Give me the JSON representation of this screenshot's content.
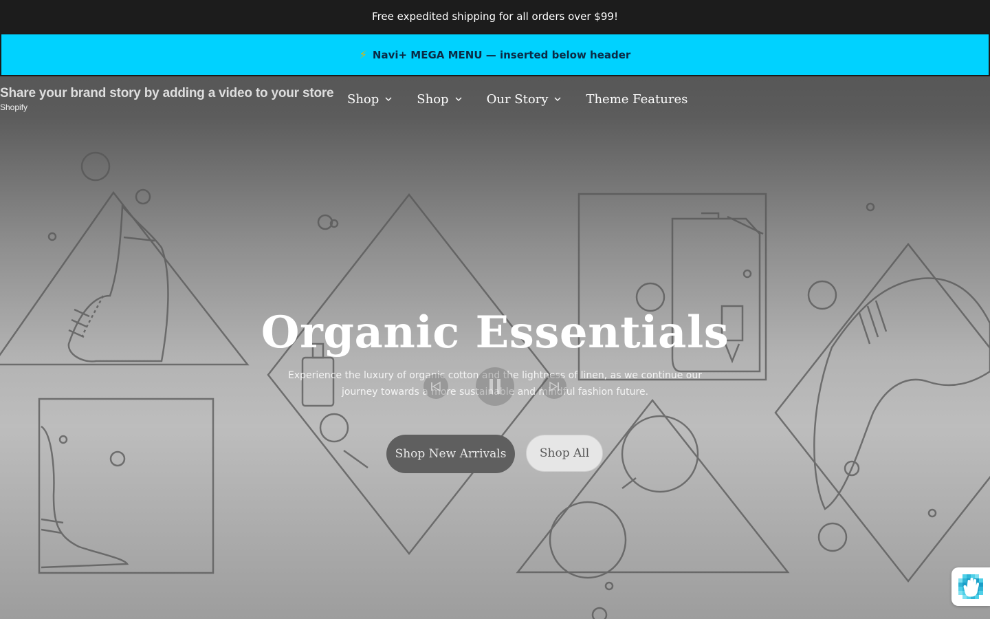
{
  "announcement": {
    "text": "Free expedited shipping for all orders over $99!"
  },
  "mega_banner": {
    "icon": "lightning-bolt-icon",
    "text": "Navi+ MEGA MENU — inserted below header",
    "background": "#00d2ff"
  },
  "video_overlay": {
    "title": "Share your brand story by adding a video to your store",
    "channel": "Shopify"
  },
  "nav": {
    "items": [
      {
        "label": "Shop",
        "has_dropdown": true
      },
      {
        "label": "Shop",
        "has_dropdown": true
      },
      {
        "label": "Our Story",
        "has_dropdown": true
      },
      {
        "label": "Theme Features",
        "has_dropdown": false
      }
    ],
    "chevron": "⌄"
  },
  "hero": {
    "title": "Organic Essentials",
    "subtitle": "Experience the luxury of organic cotton and the lightness of linen, as we continue our journey towards a more sustainable and mindful fashion future.",
    "buttons": {
      "primary": "Shop New Arrivals",
      "secondary": "Shop All"
    }
  },
  "colors": {
    "announcement_bg": "#1c1c1c",
    "primary_button_bg": "#5f5f5f",
    "secondary_button_bg": "#e6e6e6"
  },
  "widget": {
    "icon": "accessibility-hand-icon"
  }
}
